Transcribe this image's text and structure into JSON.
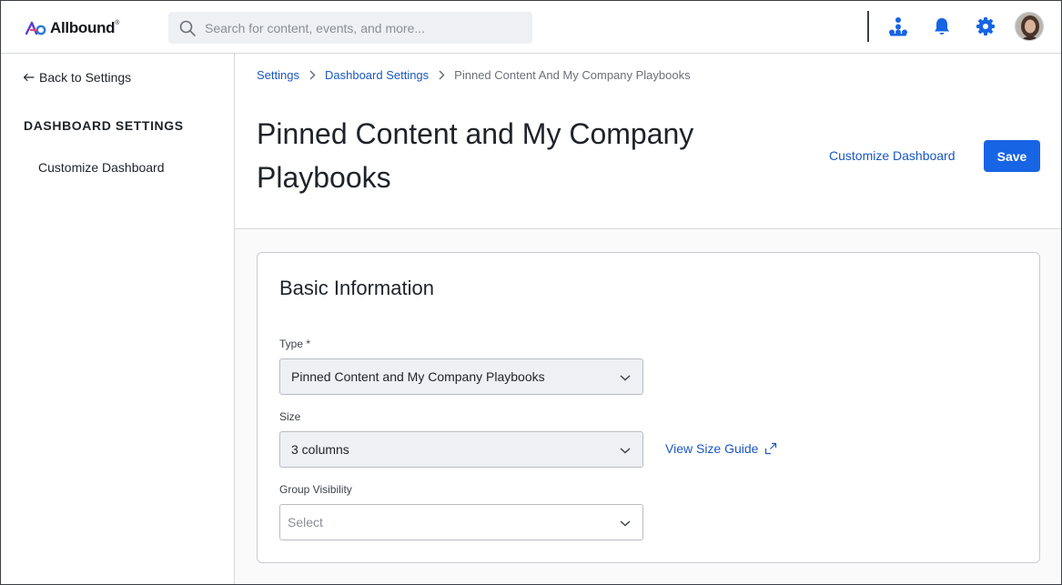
{
  "brand": {
    "name": "Allbound",
    "registered": "®",
    "accent": "#1764e4",
    "link_color": "#1a57c2"
  },
  "search": {
    "placeholder": "Search for content, events, and more..."
  },
  "topbar_icons": [
    "org-chart-icon",
    "bell-icon",
    "gear-icon",
    "avatar"
  ],
  "sidebar": {
    "back_label": "Back to Settings",
    "heading": "DASHBOARD SETTINGS",
    "items": [
      {
        "label": "Customize Dashboard"
      }
    ]
  },
  "breadcrumb": {
    "items": [
      {
        "label": "Settings"
      },
      {
        "label": "Dashboard Settings"
      }
    ],
    "current": "Pinned Content And My Company Playbooks"
  },
  "page": {
    "title": "Pinned Content and My Company Playbooks",
    "customize_link": "Customize Dashboard",
    "save_label": "Save"
  },
  "basic_info": {
    "title": "Basic Information",
    "type": {
      "label": "Type *",
      "value": "Pinned Content and My Company Playbooks"
    },
    "size": {
      "label": "Size",
      "value": "3 columns",
      "guide_link": "View Size Guide"
    },
    "group_visibility": {
      "label": "Group Visibility",
      "placeholder": "Select"
    }
  }
}
